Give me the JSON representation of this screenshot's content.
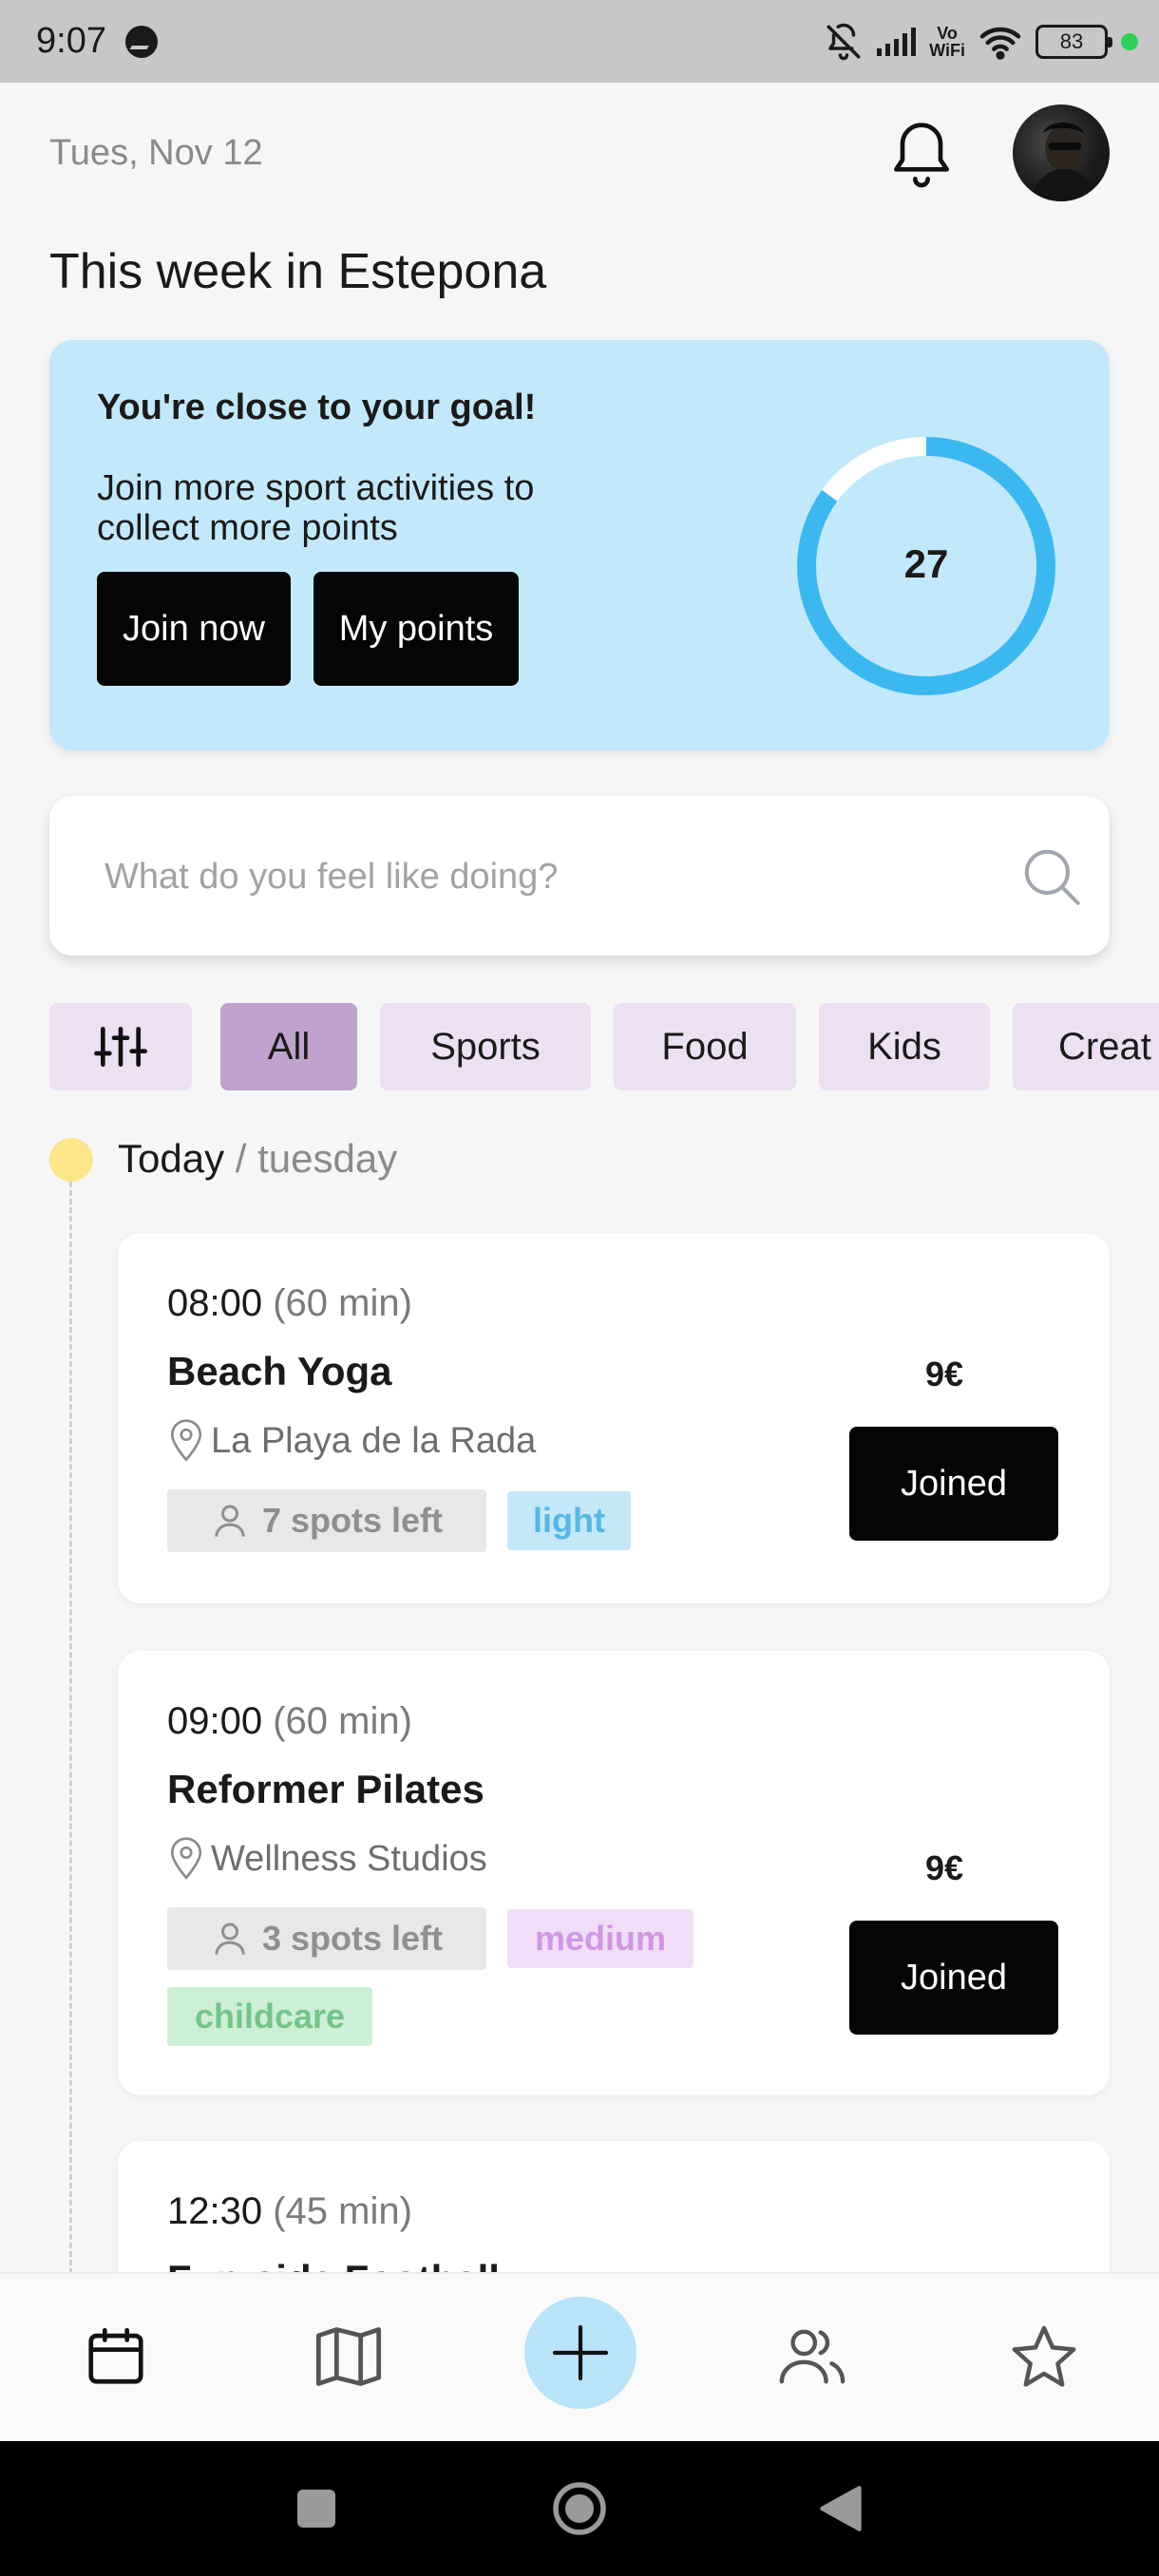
{
  "status_bar": {
    "time": "9:07",
    "network_label_top": "Vo",
    "network_label_bottom": "WiFi",
    "battery": "83"
  },
  "header": {
    "date": "Tues, Nov 12",
    "title": "This week in Estepona"
  },
  "goal_card": {
    "title": "You're close to your goal!",
    "description": "Join more sport activities to collect more points",
    "join_button": "Join now",
    "points_button": "My points",
    "points": "27",
    "progress_fraction": 0.85,
    "accent_color": "#3cb8f0",
    "track_color": "#ffffff"
  },
  "search": {
    "placeholder": "What do you feel like doing?"
  },
  "filters": {
    "items": [
      "All",
      "Sports",
      "Food",
      "Kids",
      "Creat"
    ],
    "active": "All"
  },
  "timeline": {
    "day_label": "Today",
    "day_suffix": " / tuesday"
  },
  "activities": [
    {
      "time": "08:00",
      "duration": " (60 min)",
      "title": "Beach Yoga",
      "location": "La Playa de la Rada",
      "spots": "7 spots left",
      "level": "light",
      "price": "9€",
      "button": "Joined"
    },
    {
      "time": "09:00",
      "duration": " (60 min)",
      "title": "Reformer Pilates",
      "location": "Wellness Studios",
      "spots": "3 spots left",
      "level": "medium",
      "extra_tag": "childcare",
      "price": "9€",
      "button": "Joined"
    },
    {
      "time": "12:30",
      "duration": " (45 min)",
      "title": "Fun-side Football"
    }
  ],
  "bottom_nav": {
    "items": [
      "calendar-icon",
      "map-icon",
      "plus-icon",
      "users-icon",
      "star-icon"
    ]
  }
}
